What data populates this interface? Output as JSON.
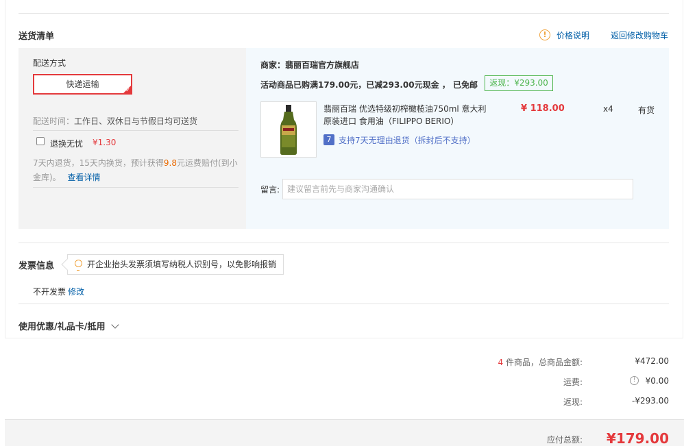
{
  "delivery": {
    "section_title": "送货清单",
    "price_note_link": "价格说明",
    "back_to_cart_link": "返回修改购物车",
    "shipping": {
      "method_label": "配送方式",
      "express_option": "快递运输",
      "time_label": "配送时间：",
      "time_value": "工作日、双休日与节假日均可送货",
      "return_option_label": "退换无忧",
      "return_option_price": "¥1.30",
      "return_desc_part1": "7天内退货，15天内换货，预计获得",
      "return_desc_highlight": "9.8",
      "return_desc_part2": "元运费赔付(到小金库)。",
      "view_details_link": "查看详情"
    },
    "goods": {
      "merchant": "商家：翡丽百瑞官方旗舰店",
      "promo_text": "活动商品已购满179.00元，已减293.00元现金 ， 已免邮",
      "rebate_tag": "返现：¥293.00",
      "product_name_line1": "翡丽百瑞 优选特级初榨橄榄油750ml 意大利",
      "product_name_line2": "原装进口 食用油（FILIPPO BERIO）",
      "price": "¥ 118.00",
      "quantity": "x4",
      "stock_status": "有货",
      "seven_day_icon": "7",
      "seven_day_text": "支持7天无理由退货（拆封后不支持）",
      "message_label": "留言:",
      "message_placeholder": "建议留言前先与商家沟通确认"
    }
  },
  "invoice": {
    "section_title": "发票信息",
    "tip": "开企业抬头发票须填写纳税人识别号，以免影响报销",
    "status": "不开发票",
    "edit_link": "修改"
  },
  "coupon": {
    "section_title": "使用优惠/礼品卡/抵用"
  },
  "summary": {
    "count": "4",
    "count_label": " 件商品，总商品金额:",
    "goods_total": "¥472.00",
    "shipping_label": "运费:",
    "shipping_value": "¥0.00",
    "rebate_label": "返现:",
    "rebate_value": "-¥293.00",
    "payable_label": "应付总额:",
    "payable_value": "¥179.00"
  },
  "colors": {
    "accent_red": "#e4393c",
    "link_blue": "#005ea7",
    "rebate_green": "#4cb44c",
    "warning_orange": "#f0a23a"
  }
}
